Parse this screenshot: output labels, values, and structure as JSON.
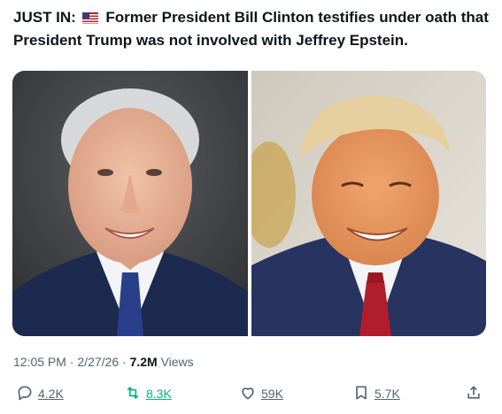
{
  "post": {
    "prefix": "JUST IN:",
    "text": "Former President Bill Clinton testifies under oath that President Trump was not involved with Jeffrey Epstein."
  },
  "media": {
    "left_photo": "clinton-portrait",
    "right_photo": "trump-portrait"
  },
  "meta": {
    "time": "12:05 PM",
    "separator": " · ",
    "date": "2/27/26",
    "views_count": "7.2M",
    "views_label": " Views"
  },
  "actions": {
    "replies": "4.2K",
    "reposts": "8.3K",
    "likes": "59K",
    "bookmarks": "5.7K"
  },
  "colors": {
    "text": "#0f1419",
    "secondary": "#536471",
    "repost_active": "#00ba7c"
  },
  "icons": [
    "us-flag-icon",
    "reply-icon",
    "repost-icon",
    "like-icon",
    "bookmark-icon",
    "share-icon"
  ]
}
